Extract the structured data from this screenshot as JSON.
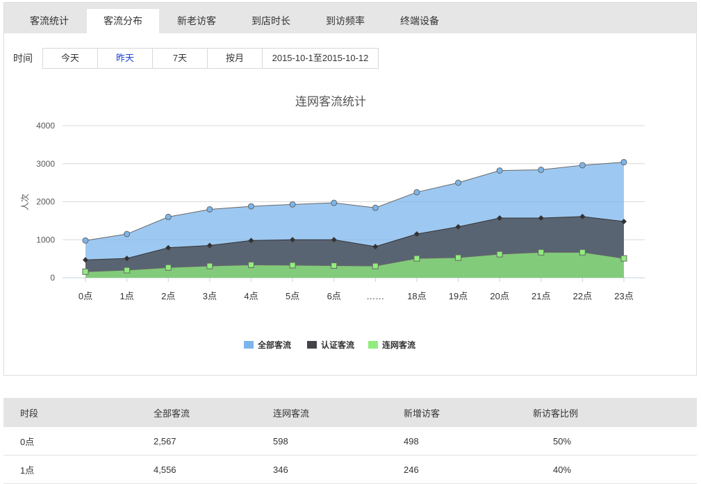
{
  "tabs": [
    {
      "label": "客流统计"
    },
    {
      "label": "客流分布",
      "active": true
    },
    {
      "label": "新老访客"
    },
    {
      "label": "到店时长"
    },
    {
      "label": "到访频率"
    },
    {
      "label": "终端设备"
    }
  ],
  "filter": {
    "label": "时间",
    "options": [
      "今天",
      "昨天",
      "7天",
      "按月",
      "2015-10-1至2015-10-12"
    ],
    "selected": "昨天"
  },
  "chart_data": {
    "type": "area",
    "title": "连网客流统计",
    "xlabel": "",
    "ylabel": "人次",
    "ylim": [
      0,
      4000
    ],
    "yticks": [
      0,
      1000,
      2000,
      3000,
      4000
    ],
    "grid": true,
    "legend": "bottom",
    "categories": [
      "0点",
      "1点",
      "2点",
      "3点",
      "4点",
      "5点",
      "6点",
      "……",
      "18点",
      "19点",
      "20点",
      "21点",
      "22点",
      "23点"
    ],
    "series": [
      {
        "name": "全部客流",
        "color": "#7cb5ec",
        "marker": "circle",
        "values": [
          980,
          1150,
          1600,
          1800,
          1880,
          1930,
          1970,
          1840,
          2250,
          2500,
          2820,
          2840,
          2960,
          3040
        ]
      },
      {
        "name": "认证客流",
        "color": "#434348",
        "marker": "diamond",
        "values": [
          470,
          510,
          790,
          850,
          980,
          1000,
          1000,
          820,
          1150,
          1340,
          1570,
          1570,
          1610,
          1480
        ]
      },
      {
        "name": "连网客流",
        "color": "#90ed7d",
        "marker": "square",
        "values": [
          160,
          200,
          270,
          310,
          340,
          330,
          320,
          310,
          510,
          530,
          620,
          670,
          670,
          510
        ]
      }
    ]
  },
  "table": {
    "headers": [
      "时段",
      "全部客流",
      "连网客流",
      "新增访客",
      "新访客比例"
    ],
    "rows": [
      [
        "0点",
        "2,567",
        "598",
        "498",
        "50%"
      ],
      [
        "1点",
        "4,556",
        "346",
        "246",
        "40%"
      ]
    ]
  }
}
